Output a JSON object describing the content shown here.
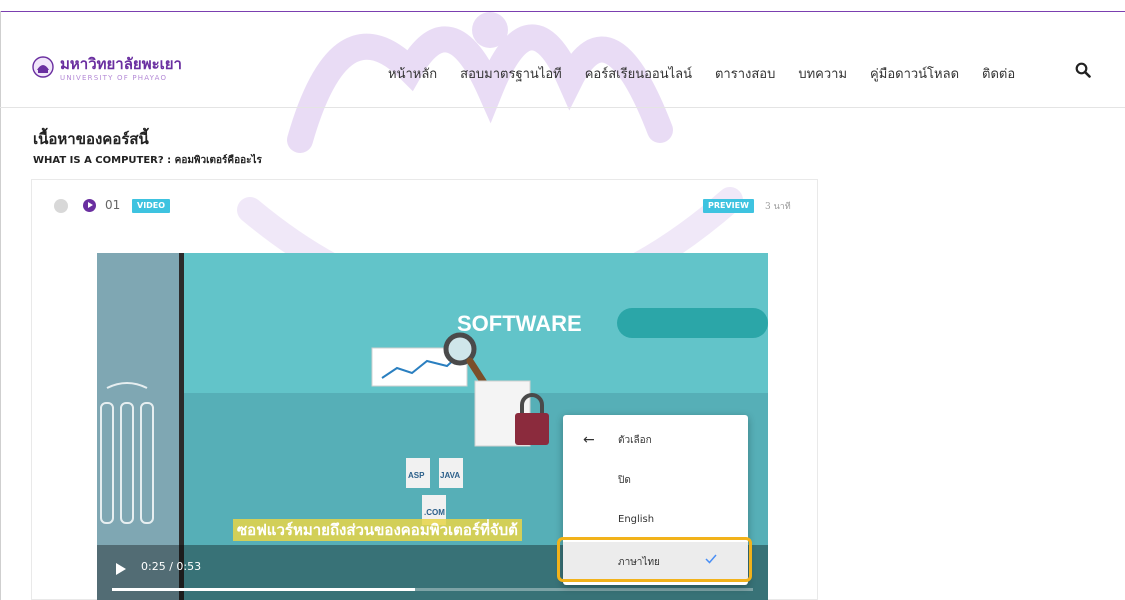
{
  "site": {
    "logo_th": "มหาวิทยาลัยพะเยา",
    "logo_en": "UNIVERSITY OF PHAYAO"
  },
  "nav": {
    "items": [
      {
        "label": "หน้าหลัก"
      },
      {
        "label": "สอบมาตรฐานไอที"
      },
      {
        "label": "คอร์สเรียนออนไลน์"
      },
      {
        "label": "ตารางสอบ"
      },
      {
        "label": "บทความ"
      },
      {
        "label": "คู่มือดาวน์โหลด"
      },
      {
        "label": "ติดต่อ"
      }
    ],
    "search_icon": "search-icon"
  },
  "course": {
    "section_title": "เนื้อหาของคอร์สนี้",
    "lesson_heading": "WHAT IS A COMPUTER? : คอมพิวเตอร์คืออะไร"
  },
  "lesson": {
    "number": "01",
    "type_badge": "VIDEO",
    "preview_badge": "PREVIEW",
    "duration": "3 นาที"
  },
  "video": {
    "scene_title": "SOFTWARE",
    "file_labels": [
      "ASP",
      "JAVA",
      ".COM"
    ],
    "subtitle": "ซอฟแวร์หมายถึงส่วนของคอมพิวเตอร์ที่จับต้",
    "time": "0:25 / 0:53",
    "progress": 0.472
  },
  "caption_menu": {
    "header": "ตัวเลือก",
    "items": [
      {
        "label": "ปิด"
      },
      {
        "label": "English"
      },
      {
        "label": "ภาษาไทย"
      }
    ],
    "selected": "ภาษาไทย"
  },
  "colors": {
    "brand_purple": "#6a2fa0",
    "badge_cyan": "#3ec3e0",
    "highlight_orange": "#f2b21a",
    "video_teal": "#62c4c9"
  }
}
